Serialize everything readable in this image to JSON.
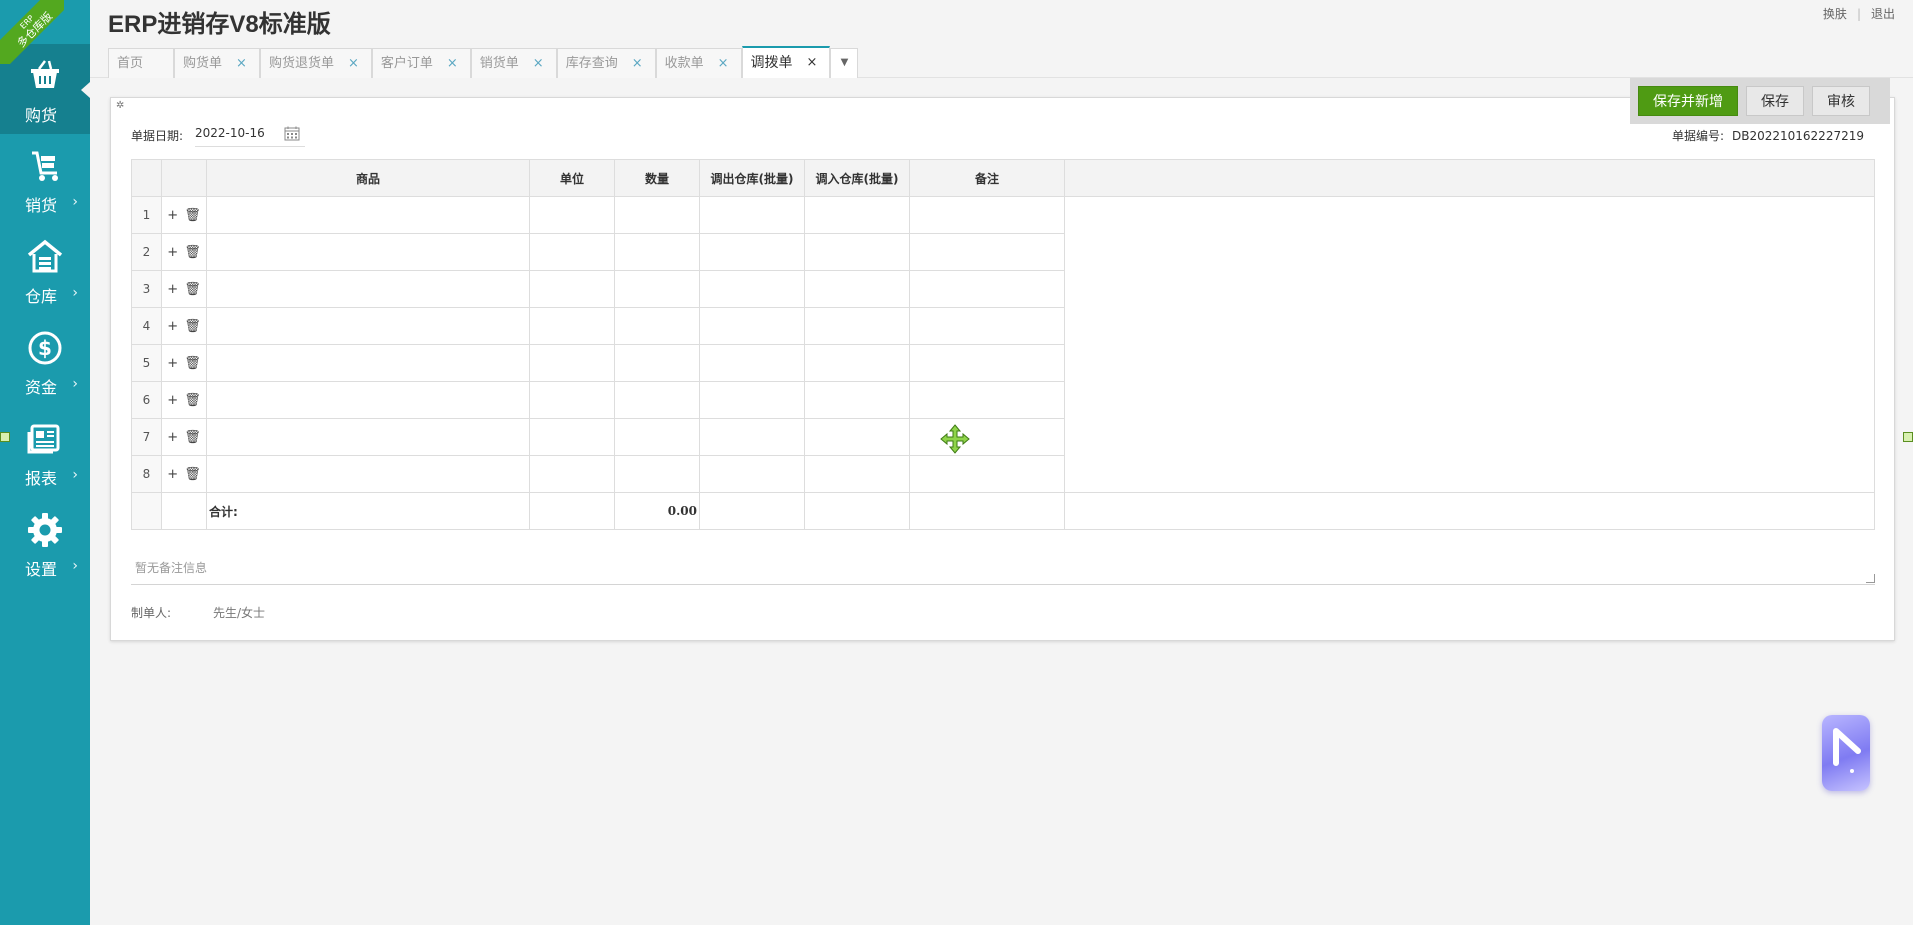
{
  "app": {
    "title": "ERP进销存V8标准版"
  },
  "ribbon": {
    "line1": "ERP",
    "line2": "多仓库版"
  },
  "header_links": {
    "skin": "换肤",
    "logout": "退出"
  },
  "sidebar": {
    "items": [
      {
        "label": "购货",
        "icon": "basket-icon",
        "active": true
      },
      {
        "label": "销货",
        "icon": "cart-icon",
        "chevron": "›"
      },
      {
        "label": "仓库",
        "icon": "warehouse-icon",
        "chevron": "›"
      },
      {
        "label": "资金",
        "icon": "dollar-icon",
        "chevron": "›"
      },
      {
        "label": "报表",
        "icon": "report-icon",
        "chevron": "›"
      },
      {
        "label": "设置",
        "icon": "gear-icon",
        "chevron": "›"
      }
    ]
  },
  "tabs": [
    {
      "label": "首页",
      "closable": false
    },
    {
      "label": "购货单",
      "close": "×"
    },
    {
      "label": "购货退货单",
      "close": "×"
    },
    {
      "label": "客户订单",
      "close": "×"
    },
    {
      "label": "销货单",
      "close": "×"
    },
    {
      "label": "库存查询",
      "close": "×"
    },
    {
      "label": "收款单",
      "close": "×"
    },
    {
      "label": "调拨单",
      "close": "×",
      "active": true
    }
  ],
  "tab_more": "▼",
  "toolbar": {
    "save_new": "保存并新增",
    "save": "保存",
    "audit": "审核"
  },
  "form": {
    "date_label": "单据日期:",
    "date_value": "2022-10-16",
    "docno_label": "单据编号:",
    "docno_value": "DB202210162227219"
  },
  "grid": {
    "headers": [
      "商品",
      "单位",
      "数量",
      "调出仓库(批量)",
      "调入仓库(批量)",
      "备注"
    ],
    "rows": [
      "1",
      "2",
      "3",
      "4",
      "5",
      "6",
      "7",
      "8"
    ],
    "add_icon": "+",
    "delete_icon": "🗑",
    "total_label": "合计:",
    "total_qty": "0.00"
  },
  "note": {
    "placeholder": "暂无备注信息"
  },
  "maker": {
    "label": "制单人:",
    "value": "先生/女士"
  },
  "colors": {
    "sidebar": "#1b9bad",
    "primary_button": "#4f9b13",
    "accent": "#1b9bad"
  }
}
